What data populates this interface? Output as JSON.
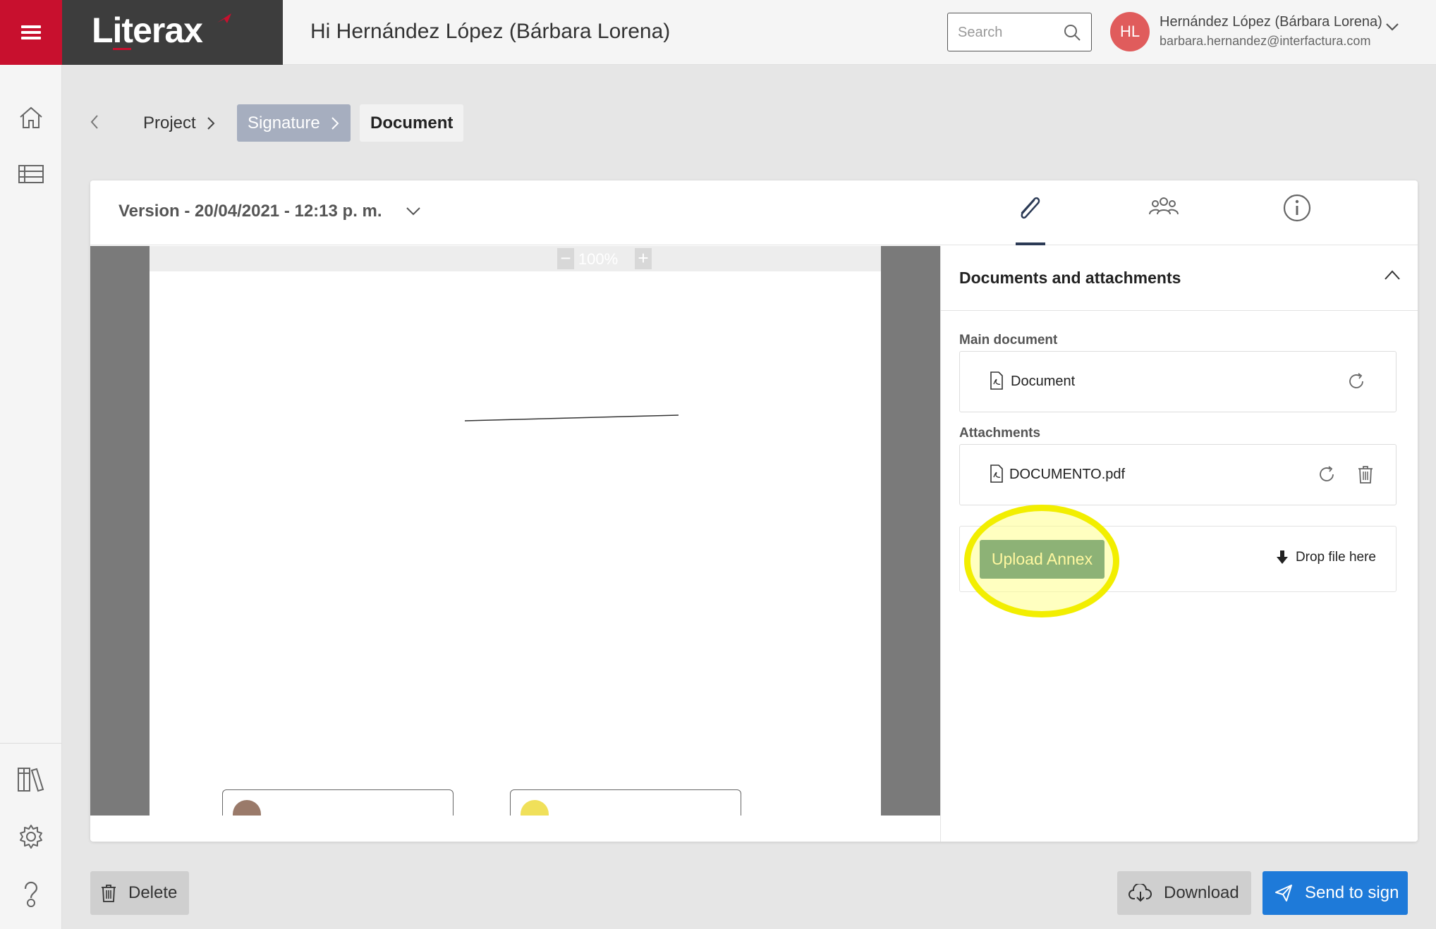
{
  "app": {
    "logo_text": "Literax",
    "greeting": "Hi Hernández López (Bárbara Lorena)",
    "brand_color": "#c8102e",
    "accent_color": "#1e7ad9"
  },
  "search": {
    "placeholder": "Search",
    "value": ""
  },
  "user": {
    "initials": "HL",
    "name": "Hernández López (Bárbara Lorena)",
    "email": "barbara.hernandez@interfactura.com"
  },
  "sidebar": {
    "top_items": [
      {
        "icon": "home-icon"
      },
      {
        "icon": "list-table-icon"
      }
    ],
    "bottom_items": [
      {
        "icon": "library-icon"
      },
      {
        "icon": "gear-icon"
      },
      {
        "icon": "help-icon"
      }
    ]
  },
  "breadcrumb": {
    "items": [
      {
        "label": "Project"
      },
      {
        "label": "Signature"
      },
      {
        "label": "Document"
      }
    ]
  },
  "document": {
    "version_label": "Version - 20/04/2021 - 12:13 p. m.",
    "tabs": [
      {
        "icon": "paperclip-icon",
        "active": true
      },
      {
        "icon": "users-icon",
        "active": false
      },
      {
        "icon": "info-icon",
        "active": false
      }
    ],
    "viewer": {
      "zoom_level": "100%",
      "zoom_out": "−",
      "zoom_in": "+",
      "signature_badge_colors": [
        "#9a7a6a",
        "#f0e05a"
      ]
    }
  },
  "panel": {
    "title": "Documents and attachments",
    "main_document_label": "Main document",
    "main_document_name": "Document",
    "attachments_label": "Attachments",
    "attachments": [
      {
        "name": "DOCUMENTO.pdf"
      }
    ],
    "upload_button": "Upload Annex",
    "drop_text": "Drop file here"
  },
  "actions": {
    "delete": "Delete",
    "download": "Download",
    "send": "Send to sign"
  }
}
